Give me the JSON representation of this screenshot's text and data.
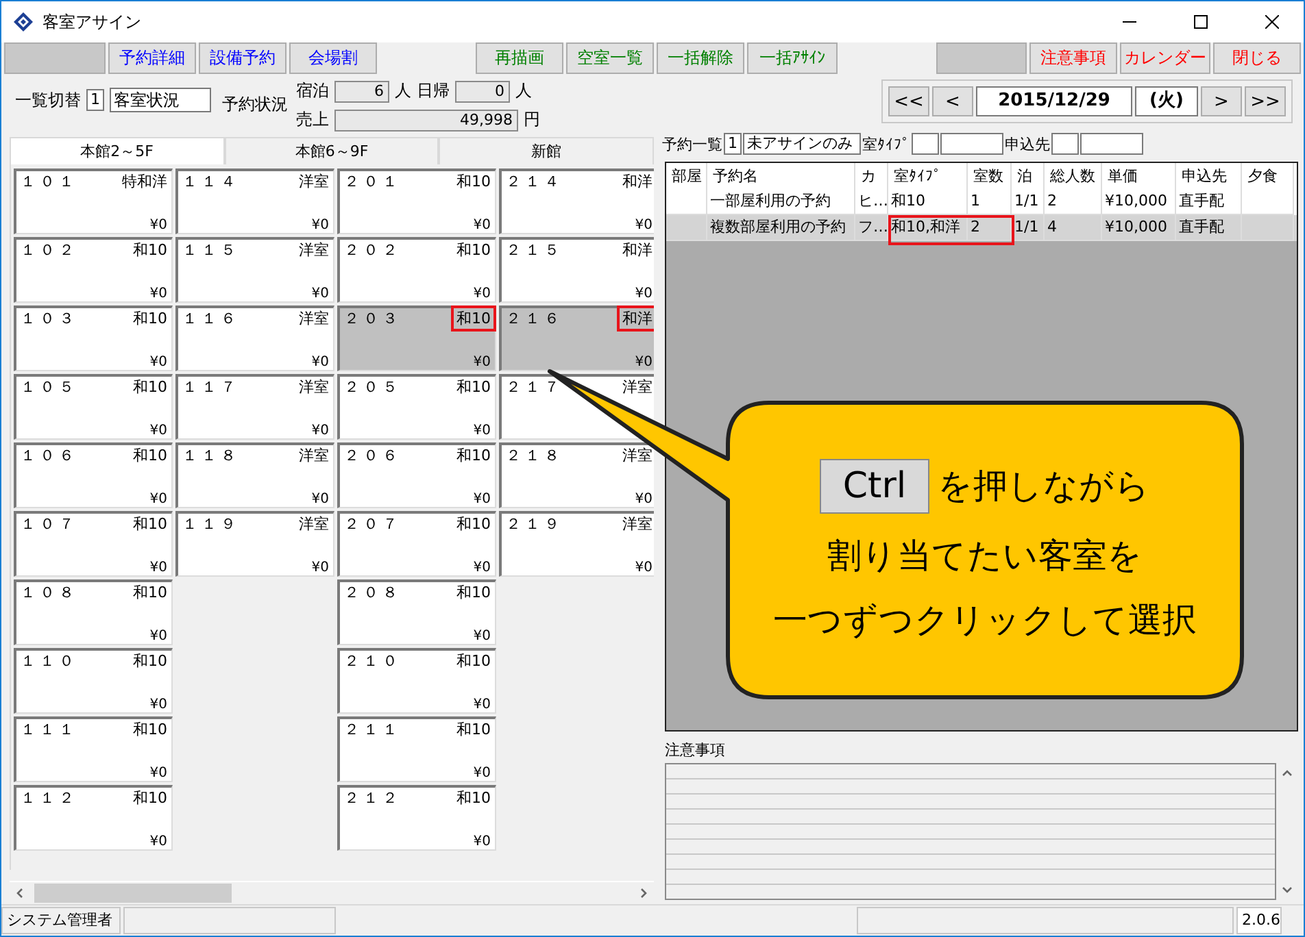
{
  "window": {
    "title": "客室アサイン"
  },
  "toolbar": [
    {
      "kind": "blank"
    },
    {
      "kind": "button",
      "label": "予約詳細",
      "color": "#0000ff"
    },
    {
      "kind": "button",
      "label": "設備予約",
      "color": "#0000ff"
    },
    {
      "kind": "button",
      "label": "会場割",
      "color": "#0000ff"
    },
    {
      "kind": "gap"
    },
    {
      "kind": "button",
      "label": "再描画",
      "color": "#008000"
    },
    {
      "kind": "button",
      "label": "空室一覧",
      "color": "#008000"
    },
    {
      "kind": "button",
      "label": "一括解除",
      "color": "#008000"
    },
    {
      "kind": "button",
      "label": "一括ｱｻｲﾝ",
      "color": "#008000"
    },
    {
      "kind": "gap"
    },
    {
      "kind": "blank"
    },
    {
      "kind": "button",
      "label": "注意事項",
      "color": "#ff0000"
    },
    {
      "kind": "button",
      "label": "カレンダー",
      "color": "#ff0000"
    },
    {
      "kind": "button",
      "label": "閉じる",
      "color": "#ff0000"
    }
  ],
  "view_switch": {
    "label": "一覧切替",
    "code": "1",
    "value": "客室状況"
  },
  "reservation_status": {
    "label": "予約状況",
    "stay_label": "宿泊",
    "stay_value": "6",
    "stay_unit": "人",
    "day_label": "日帰",
    "day_value": "0",
    "day_unit": "人",
    "sales_label": "売上",
    "sales_value": "49,998",
    "sales_unit": "円"
  },
  "date_nav": {
    "first": "<<",
    "prev": "<",
    "date": "2015/12/29",
    "weekday": "(火)",
    "next": ">",
    "last": ">>"
  },
  "tabs": [
    {
      "label": "本館2～5F",
      "selected": true
    },
    {
      "label": "本館6～9F",
      "selected": false
    },
    {
      "label": "新館",
      "selected": false
    }
  ],
  "room_columns": [
    [
      {
        "number": "１０１",
        "type": "特和洋",
        "price": "¥0",
        "selected": false,
        "highlighted": false
      },
      {
        "number": "１０２",
        "type": "和10",
        "price": "¥0",
        "selected": false,
        "highlighted": false
      },
      {
        "number": "１０３",
        "type": "和10",
        "price": "¥0",
        "selected": false,
        "highlighted": false
      },
      {
        "number": "１０５",
        "type": "和10",
        "price": "¥0",
        "selected": false,
        "highlighted": false
      },
      {
        "number": "１０６",
        "type": "和10",
        "price": "¥0",
        "selected": false,
        "highlighted": false
      },
      {
        "number": "１０７",
        "type": "和10",
        "price": "¥0",
        "selected": false,
        "highlighted": false
      },
      {
        "number": "１０８",
        "type": "和10",
        "price": "¥0",
        "selected": false,
        "highlighted": false
      },
      {
        "number": "１１０",
        "type": "和10",
        "price": "¥0",
        "selected": false,
        "highlighted": false
      },
      {
        "number": "１１１",
        "type": "和10",
        "price": "¥0",
        "selected": false,
        "highlighted": false
      },
      {
        "number": "１１２",
        "type": "和10",
        "price": "¥0",
        "selected": false,
        "highlighted": false
      }
    ],
    [
      {
        "number": "１１４",
        "type": "洋室",
        "price": "¥0",
        "selected": false,
        "highlighted": false
      },
      {
        "number": "１１５",
        "type": "洋室",
        "price": "¥0",
        "selected": false,
        "highlighted": false
      },
      {
        "number": "１１６",
        "type": "洋室",
        "price": "¥0",
        "selected": false,
        "highlighted": false
      },
      {
        "number": "１１７",
        "type": "洋室",
        "price": "¥0",
        "selected": false,
        "highlighted": false
      },
      {
        "number": "１１８",
        "type": "洋室",
        "price": "¥0",
        "selected": false,
        "highlighted": false
      },
      {
        "number": "１１９",
        "type": "洋室",
        "price": "¥0",
        "selected": false,
        "highlighted": false
      }
    ],
    [
      {
        "number": "２０１",
        "type": "和10",
        "price": "¥0",
        "selected": false,
        "highlighted": false
      },
      {
        "number": "２０２",
        "type": "和10",
        "price": "¥0",
        "selected": false,
        "highlighted": false
      },
      {
        "number": "２０３",
        "type": "和10",
        "price": "¥0",
        "selected": true,
        "highlighted": true
      },
      {
        "number": "２０５",
        "type": "和10",
        "price": "¥0",
        "selected": false,
        "highlighted": false
      },
      {
        "number": "２０６",
        "type": "和10",
        "price": "¥0",
        "selected": false,
        "highlighted": false
      },
      {
        "number": "２０７",
        "type": "和10",
        "price": "¥0",
        "selected": false,
        "highlighted": false
      },
      {
        "number": "２０８",
        "type": "和10",
        "price": "¥0",
        "selected": false,
        "highlighted": false
      },
      {
        "number": "２１０",
        "type": "和10",
        "price": "¥0",
        "selected": false,
        "highlighted": false
      },
      {
        "number": "２１１",
        "type": "和10",
        "price": "¥0",
        "selected": false,
        "highlighted": false
      },
      {
        "number": "２１２",
        "type": "和10",
        "price": "¥0",
        "selected": false,
        "highlighted": false
      }
    ],
    [
      {
        "number": "２１４",
        "type": "和洋",
        "price": "¥0",
        "selected": false,
        "highlighted": false
      },
      {
        "number": "２１５",
        "type": "和洋",
        "price": "¥0",
        "selected": false,
        "highlighted": false
      },
      {
        "number": "２１６",
        "type": "和洋",
        "price": "¥0",
        "selected": true,
        "highlighted": true
      },
      {
        "number": "２１７",
        "type": "洋室",
        "selected": false,
        "highlighted": false
      },
      {
        "number": "２１８",
        "type": "洋室",
        "price": "¥0",
        "selected": false,
        "highlighted": false
      },
      {
        "number": "２１９",
        "type": "洋室",
        "price": "¥0",
        "selected": false,
        "highlighted": false
      }
    ]
  ],
  "reservation_filter": {
    "label": "予約一覧",
    "code": "1",
    "value": "未アサインのみ",
    "room_type_label": "室ﾀｲﾌﾟ",
    "source_label": "申込先"
  },
  "reservation_table": {
    "columns": [
      "部屋",
      "予約名",
      "カ",
      "室ﾀｲﾌﾟ",
      "室数",
      "泊",
      "総人数",
      "単価",
      "申込先",
      "夕食"
    ],
    "rows": [
      {
        "name": "一部屋利用の予約",
        "kana": "ヒ…",
        "room_type": "和10",
        "rooms": "1",
        "nights": "1/1",
        "guests": "2",
        "price": "¥10,000",
        "source": "直手配",
        "selected": false,
        "highlighted": false
      },
      {
        "name": "複数部屋利用の予約",
        "kana": "フ…",
        "room_type": "和10,和洋",
        "rooms": "2",
        "nights": "1/1",
        "guests": "4",
        "price": "¥10,000",
        "source": "直手配",
        "selected": true,
        "highlighted": true
      }
    ]
  },
  "notes": {
    "label": "注意事項"
  },
  "status_bar": {
    "user": "システム管理者",
    "version": "2.0.6"
  },
  "callout": {
    "key": "Ctrl",
    "lines": [
      "を押しながら",
      "割り当てたい客室を",
      "一つずつクリックして選択"
    ]
  }
}
